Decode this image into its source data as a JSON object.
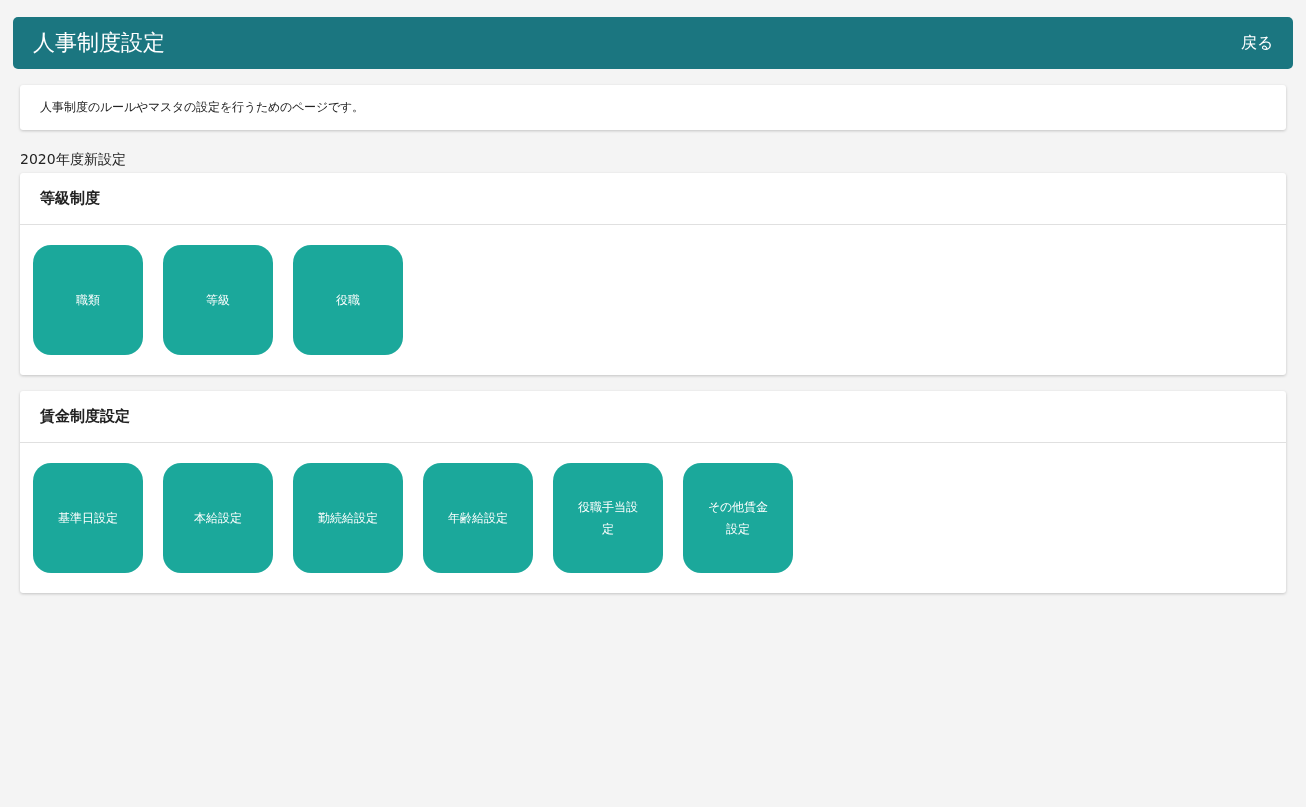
{
  "header": {
    "title": "人事制度設定",
    "back_link": "戻る"
  },
  "description": "人事制度のルールやマスタの設定を行うためのページです。",
  "section_label": "2020年度新設定",
  "cards": [
    {
      "title": "等級制度",
      "buttons": [
        "職類",
        "等級",
        "役職"
      ]
    },
    {
      "title": "賃金制度設定",
      "buttons": [
        "基準日設定",
        "本給設定",
        "勤続給設定",
        "年齢給設定",
        "役職手当設定",
        "その他賃金設定"
      ]
    }
  ]
}
